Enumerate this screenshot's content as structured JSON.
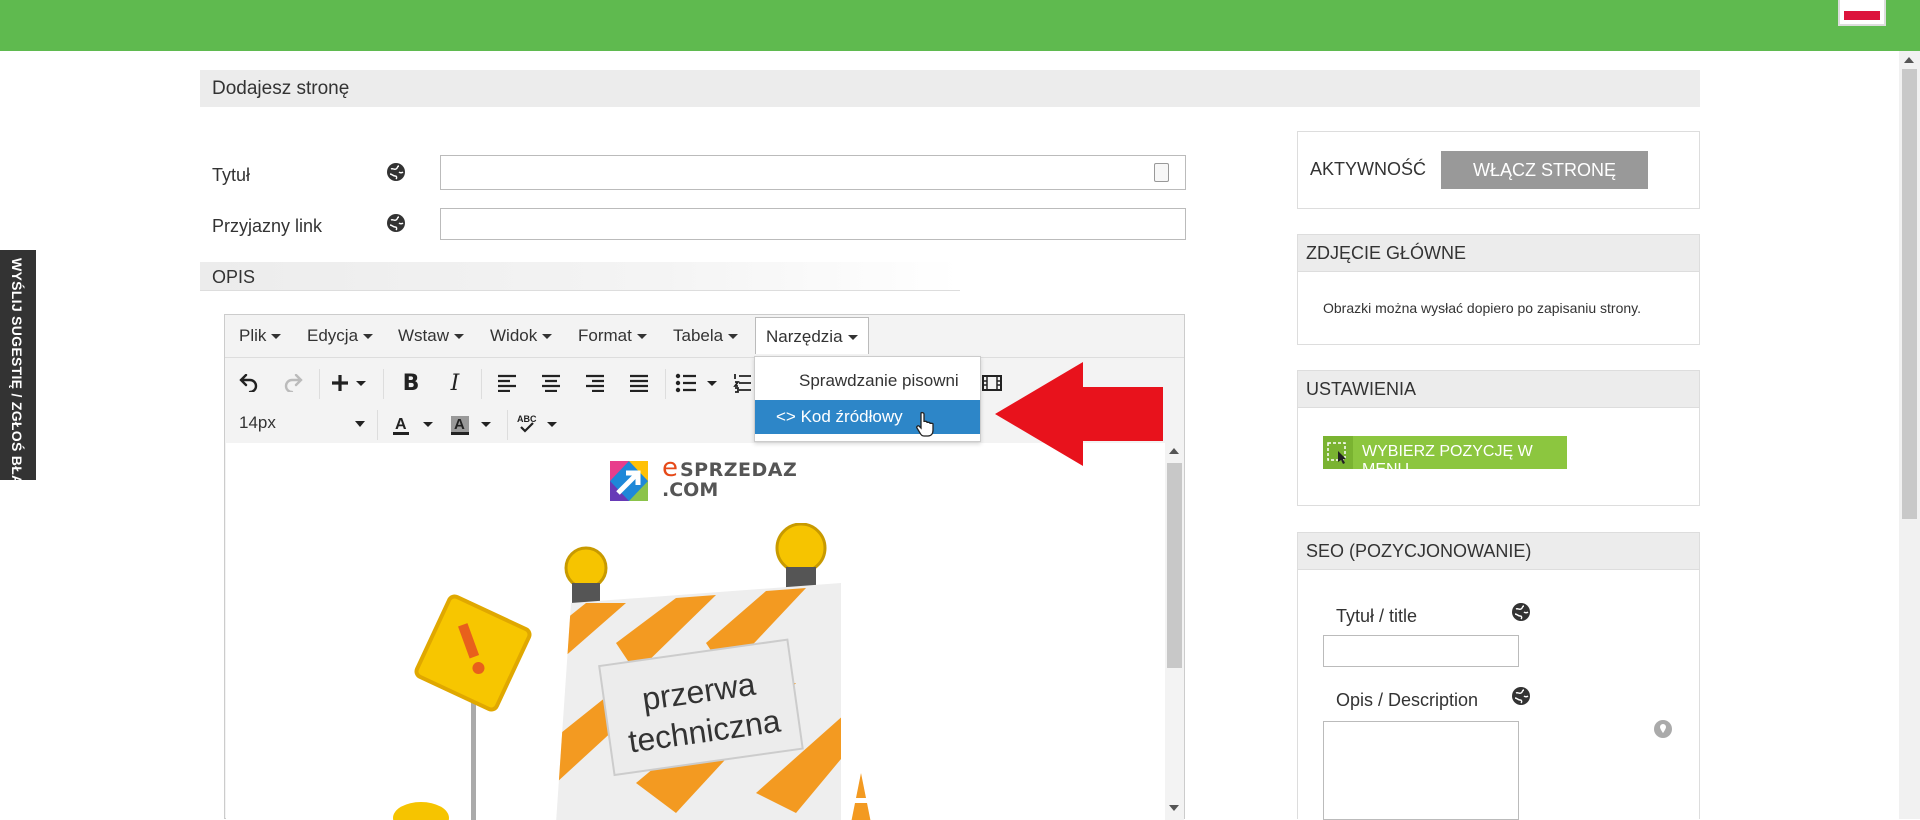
{
  "header": {
    "flag": "pl-flag"
  },
  "page": {
    "title": "Dodajesz stronę"
  },
  "form": {
    "title_label": "Tytuł",
    "title_value": "",
    "link_label": "Przyjazny link",
    "link_value": "",
    "opis_label": "OPIS"
  },
  "editor": {
    "menu": [
      "Plik",
      "Edycja",
      "Wstaw",
      "Widok",
      "Format",
      "Tabela",
      "Narzędzia"
    ],
    "font_size": "14px",
    "dropdown": {
      "spellcheck": "Sprawdzanie pisowni",
      "source_code": "<> Kod źródłowy"
    },
    "content": {
      "logo_e": "e",
      "logo_text": "SPRZEDAZ",
      "logo_com": ".COM",
      "sign_line1": "przerwa",
      "sign_line2": "techniczna"
    }
  },
  "sidebar": {
    "activity_label": "AKTYWNOŚĆ",
    "enable_button": "WŁĄCZ STRONĘ",
    "photo_title": "ZDJĘCIE GŁÓWNE",
    "photo_note": "Obrazki można wysłać dopiero po zapisaniu strony.",
    "settings_title": "USTAWIENIA",
    "menu_button": "WYBIERZ POZYCJĘ W MENU",
    "seo_title": "SEO (POZYCJONOWANIE)",
    "seo_title_label": "Tytuł / title",
    "seo_title_value": "",
    "seo_desc_label": "Opis / Description",
    "seo_desc_value": ""
  },
  "side_tab": "WYŚLIJ SUGESTIĘ / ZGŁOŚ BŁĄD",
  "colors": {
    "green": "#5fba4f",
    "accent_green": "#8cc63f",
    "dropdown_active": "#2d86c8",
    "arrow": "#e8121c"
  }
}
